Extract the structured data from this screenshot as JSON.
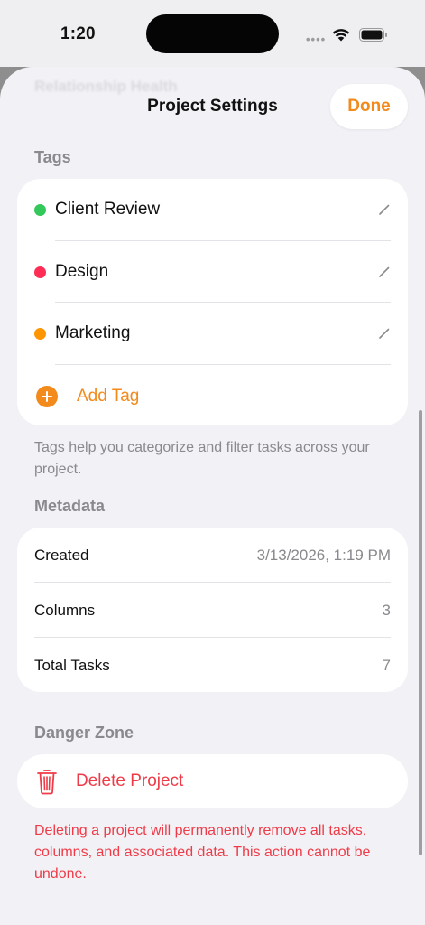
{
  "status_bar": {
    "time": "1:20",
    "signal_dots": "••••",
    "wifi_icon": "wifi-icon",
    "battery_icon": "battery-icon"
  },
  "sheet": {
    "background_title": "Relationship Health",
    "title": "Project Settings",
    "done_label": "Done"
  },
  "colors": {
    "accent": "#F28A1C",
    "danger": "#EF3B48",
    "tag_client_review": "#34C759",
    "tag_design": "#FF2D55",
    "tag_marketing": "#FF9500"
  },
  "tags": {
    "header": "Tags",
    "items": [
      {
        "name": "Client Review",
        "color": "#34C759"
      },
      {
        "name": "Design",
        "color": "#FF2D55"
      },
      {
        "name": "Marketing",
        "color": "#FF9500"
      }
    ],
    "add_label": "Add Tag",
    "footer": "Tags help you categorize and filter tasks across your project."
  },
  "metadata": {
    "header": "Metadata",
    "rows": [
      {
        "label": "Created",
        "value": "3/13/2026, 1:19 PM"
      },
      {
        "label": "Columns",
        "value": "3"
      },
      {
        "label": "Total Tasks",
        "value": "7"
      }
    ]
  },
  "danger_zone": {
    "header": "Danger Zone",
    "delete_label": "Delete Project",
    "warning": "Deleting a project will permanently remove all tasks, columns, and associated data. This action cannot be undone."
  }
}
